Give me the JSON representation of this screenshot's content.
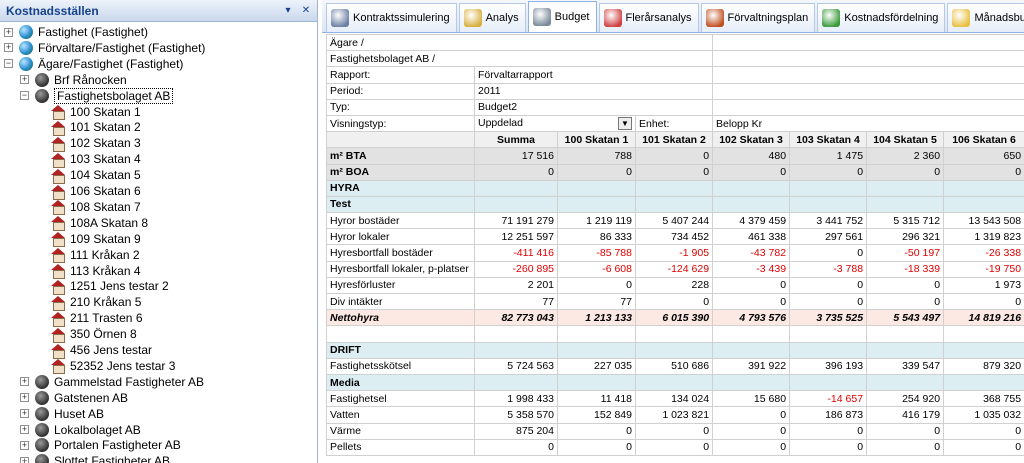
{
  "left": {
    "title": "Kostnadsställen",
    "pin_glyph": "▾ ⊣",
    "close_glyph": "✕",
    "nodes": [
      {
        "label": "Fastighet (Fastighet)",
        "level": 0,
        "icon": "globe-icon",
        "expander": "+"
      },
      {
        "label": "Förvaltare/Fastighet (Fastighet)",
        "level": 0,
        "icon": "globe-icon",
        "expander": "+"
      },
      {
        "label": "Ägare/Fastighet (Fastighet)",
        "level": 0,
        "icon": "globe-icon",
        "expander": "−"
      },
      {
        "label": "Brf Rånocken",
        "level": 1,
        "icon": "group-icon",
        "expander": "+"
      },
      {
        "label": "Fastighetsbolaget AB",
        "level": 1,
        "icon": "group-icon",
        "expander": "−",
        "selected": true
      },
      {
        "label": "100 Skatan 1",
        "level": 2,
        "icon": "house-icon"
      },
      {
        "label": "101 Skatan 2",
        "level": 2,
        "icon": "house-icon"
      },
      {
        "label": "102 Skatan 3",
        "level": 2,
        "icon": "house-icon"
      },
      {
        "label": "103 Skatan 4",
        "level": 2,
        "icon": "house-icon"
      },
      {
        "label": "104 Skatan 5",
        "level": 2,
        "icon": "house-icon"
      },
      {
        "label": "106 Skatan 6",
        "level": 2,
        "icon": "house-icon"
      },
      {
        "label": "108 Skatan 7",
        "level": 2,
        "icon": "house-icon"
      },
      {
        "label": "108A Skatan 8",
        "level": 2,
        "icon": "house-icon"
      },
      {
        "label": "109 Skatan 9",
        "level": 2,
        "icon": "house-icon"
      },
      {
        "label": "111 Kråkan 2",
        "level": 2,
        "icon": "house-icon"
      },
      {
        "label": "113 Kråkan 4",
        "level": 2,
        "icon": "house-icon"
      },
      {
        "label": "1251 Jens testar 2",
        "level": 2,
        "icon": "house-icon"
      },
      {
        "label": "210 Kråkan 5",
        "level": 2,
        "icon": "house-icon"
      },
      {
        "label": "211 Trasten 6",
        "level": 2,
        "icon": "house-icon"
      },
      {
        "label": "350 Örnen 8",
        "level": 2,
        "icon": "house-icon"
      },
      {
        "label": "456 Jens testar",
        "level": 2,
        "icon": "house-icon"
      },
      {
        "label": "52352 Jens testar 3",
        "level": 2,
        "icon": "house-icon"
      },
      {
        "label": "Gammelstad Fastigheter AB",
        "level": 1,
        "icon": "group-icon",
        "expander": "+"
      },
      {
        "label": "Gatstenen AB",
        "level": 1,
        "icon": "group-icon",
        "expander": "+"
      },
      {
        "label": "Huset AB",
        "level": 1,
        "icon": "group-icon",
        "expander": "+"
      },
      {
        "label": "Lokalbolaget AB",
        "level": 1,
        "icon": "group-icon",
        "expander": "+"
      },
      {
        "label": "Portalen Fastigheter AB",
        "level": 1,
        "icon": "group-icon",
        "expander": "+"
      },
      {
        "label": "Slottet Fastigheter AB",
        "level": 1,
        "icon": "group-icon",
        "expander": "+"
      }
    ]
  },
  "tabs": [
    {
      "label": "Kontraktssimulering",
      "icon": "contract-icon",
      "color": "#6b7fa3"
    },
    {
      "label": "Analys",
      "icon": "magnifier-icon",
      "color": "#d8b040"
    },
    {
      "label": "Budget",
      "icon": "calculator-icon",
      "color": "#7a8a9a",
      "active": true
    },
    {
      "label": "Flerårsanalys",
      "icon": "calendar-icon",
      "color": "#d04040"
    },
    {
      "label": "Förvaltningsplan",
      "icon": "target-icon",
      "color": "#c05020"
    },
    {
      "label": "Kostnadsfördelning",
      "icon": "leaf-icon",
      "color": "#3a9a3a"
    },
    {
      "label": "Månadsbudget",
      "icon": "notes-icon",
      "color": "#e8c040"
    }
  ],
  "info": {
    "agare": "Ägare /",
    "bolag": "Fastighetsbolaget AB /",
    "rapport_label": "Rapport:",
    "rapport_value": "Förvaltarrapport",
    "period_label": "Period:",
    "period_value": "2011",
    "typ_label": "Typ:",
    "typ_value": "Budget2",
    "visning_label": "Visningstyp:",
    "visning_value": "Uppdelad",
    "enhet_label": "Enhet:",
    "enhet_value": "Belopp Kr"
  },
  "columns": [
    "Summa",
    "100 Skatan 1",
    "101 Skatan 2",
    "102 Skatan 3",
    "103 Skatan 4",
    "104 Skatan 5",
    "106 Skatan 6"
  ],
  "rows": [
    {
      "kind": "gray",
      "label": "m² BTA",
      "values": [
        "17 516",
        "788",
        "0",
        "480",
        "1 475",
        "2 360",
        "650"
      ]
    },
    {
      "kind": "gray",
      "label": "m² BOA",
      "values": [
        "0",
        "0",
        "0",
        "0",
        "0",
        "0",
        "0"
      ]
    },
    {
      "kind": "section",
      "label": "HYRA",
      "values": [
        "",
        "",
        "",
        "",
        "",
        "",
        ""
      ]
    },
    {
      "kind": "section",
      "label": "Test",
      "values": [
        "",
        "",
        "",
        "",
        "",
        "",
        ""
      ]
    },
    {
      "kind": "data",
      "label": "Hyror bostäder",
      "values": [
        "71 191 279",
        "1 219 119",
        "5 407 244",
        "4 379 459",
        "3 441 752",
        "5 315 712",
        "13 543 508"
      ]
    },
    {
      "kind": "data",
      "label": "Hyror lokaler",
      "values": [
        "12 251 597",
        "86 333",
        "734 452",
        "461 338",
        "297 561",
        "296 321",
        "1 319 823"
      ]
    },
    {
      "kind": "data",
      "label": "Hyresbortfall bostäder",
      "values": [
        "-411 416",
        "-85 788",
        "-1 905",
        "-43 782",
        "0",
        "-50 197",
        "-26 338"
      ]
    },
    {
      "kind": "data",
      "label": "Hyresbortfall lokaler, p-platser",
      "values": [
        "-260 895",
        "-6 608",
        "-124 629",
        "-3 439",
        "-3 788",
        "-18 339",
        "-19 750"
      ]
    },
    {
      "kind": "data",
      "label": "Hyresförluster",
      "values": [
        "2 201",
        "0",
        "228",
        "0",
        "0",
        "0",
        "1 973"
      ]
    },
    {
      "kind": "data",
      "label": "Div intäkter",
      "values": [
        "77",
        "77",
        "0",
        "0",
        "0",
        "0",
        "0"
      ]
    },
    {
      "kind": "total",
      "label": "Nettohyra",
      "values": [
        "82 773 043",
        "1 213 133",
        "6 015 390",
        "4 793 576",
        "3 735 525",
        "5 543 497",
        "14 819 216"
      ]
    },
    {
      "kind": "blank",
      "label": "",
      "values": [
        "",
        "",
        "",
        "",
        "",
        "",
        ""
      ]
    },
    {
      "kind": "section",
      "label": "DRIFT",
      "values": [
        "",
        "",
        "",
        "",
        "",
        "",
        ""
      ]
    },
    {
      "kind": "data",
      "label": "Fastighetsskötsel",
      "values": [
        "5 724 563",
        "227 035",
        "510 686",
        "391 922",
        "396 193",
        "339 547",
        "879 320"
      ]
    },
    {
      "kind": "section",
      "label": "Media",
      "values": [
        "",
        "",
        "",
        "",
        "",
        "",
        ""
      ]
    },
    {
      "kind": "data",
      "label": "Fastighetsel",
      "values": [
        "1 998 433",
        "11 418",
        "134 024",
        "15 680",
        "-14 657",
        "254 920",
        "368 755"
      ]
    },
    {
      "kind": "data",
      "label": "Vatten",
      "values": [
        "5 358 570",
        "152 849",
        "1 023 821",
        "0",
        "186 873",
        "416 179",
        "1 035 032"
      ]
    },
    {
      "kind": "data",
      "label": "Värme",
      "values": [
        "875 204",
        "0",
        "0",
        "0",
        "0",
        "0",
        "0"
      ]
    },
    {
      "kind": "data",
      "label": "Pellets",
      "values": [
        "0",
        "0",
        "0",
        "0",
        "0",
        "0",
        "0"
      ]
    }
  ]
}
